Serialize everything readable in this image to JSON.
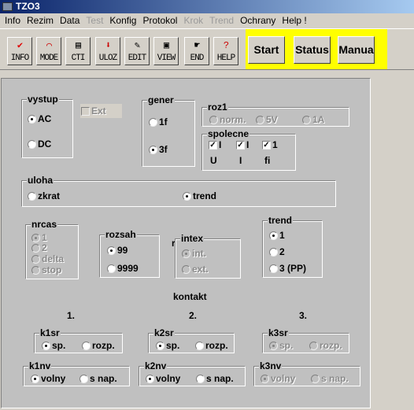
{
  "window": {
    "title": "TZO3"
  },
  "menu": [
    {
      "label": "Info",
      "enabled": true
    },
    {
      "label": "Rezim",
      "enabled": true
    },
    {
      "label": "Data",
      "enabled": true
    },
    {
      "label": "Test",
      "enabled": false
    },
    {
      "label": "Konfig",
      "enabled": true
    },
    {
      "label": "Protokol",
      "enabled": true
    },
    {
      "label": "Krok",
      "enabled": false
    },
    {
      "label": "Trend",
      "enabled": false
    },
    {
      "label": "Ochrany",
      "enabled": true
    },
    {
      "label": "Help !",
      "enabled": true
    }
  ],
  "toolbar": [
    {
      "label": "INFO",
      "icon": "checkmark-icon"
    },
    {
      "label": "MODE",
      "icon": "chart-icon"
    },
    {
      "label": "CTI",
      "icon": "document-icon"
    },
    {
      "label": "ULOZ",
      "icon": "save-icon"
    },
    {
      "label": "EDIT",
      "icon": "edit-icon"
    },
    {
      "label": "VIEW",
      "icon": "view-icon"
    },
    {
      "label": "END",
      "icon": "exit-icon"
    },
    {
      "label": "HELP",
      "icon": "help-icon"
    }
  ],
  "actions": {
    "start": "Start",
    "status": "Status",
    "manual": "Manua",
    "highlight": "#ffff00"
  },
  "vystup": {
    "label": "vystup",
    "options": [
      "AC",
      "DC"
    ],
    "selected": "AC"
  },
  "ext": {
    "label": "Ext",
    "checked": false,
    "enabled": false
  },
  "gener": {
    "label": "gener",
    "options": [
      "1f",
      "3f"
    ],
    "selected": "3f"
  },
  "roz1": {
    "label": "roz1",
    "options": [
      "norm.",
      "5V",
      "1A"
    ],
    "selected": null,
    "enabled": false
  },
  "spolecne": {
    "label": "spolecne",
    "checks": [
      {
        "mark": "I",
        "label": "U",
        "checked": true
      },
      {
        "mark": "I",
        "label": "I",
        "checked": true
      },
      {
        "mark": "1",
        "label": "fi",
        "checked": true
      }
    ]
  },
  "uloha": {
    "label": "uloha",
    "options": [
      "zkrat",
      "trend"
    ],
    "selected": "trend"
  },
  "nrcas": {
    "label": "nrcas",
    "options": [
      "1",
      "2",
      "delta",
      "stop"
    ],
    "selected": "1",
    "enabled": false
  },
  "rozsah": {
    "label": "rozsah",
    "options": [
      "99",
      "9999"
    ],
    "selected": "99"
  },
  "stray_label": "r",
  "intex": {
    "label": "intex",
    "options": [
      "int.",
      "ext."
    ],
    "selected": "int.",
    "enabled": false
  },
  "trend": {
    "label": "trend",
    "options": [
      "1",
      "2",
      "3 (PP)"
    ],
    "selected": "1"
  },
  "kontakt": {
    "label": "kontakt",
    "columns": [
      "1.",
      "2.",
      "3."
    ]
  },
  "k1sr": {
    "label": "k1sr",
    "options": [
      "sp.",
      "rozp."
    ],
    "selected": "sp."
  },
  "k2sr": {
    "label": "k2sr",
    "options": [
      "sp.",
      "rozp."
    ],
    "selected": "sp."
  },
  "k3sr": {
    "label": "k3sr",
    "options": [
      "sp.",
      "rozp."
    ],
    "selected": "sp.",
    "enabled": false
  },
  "k1nv": {
    "label": "k1nv",
    "options": [
      "volny",
      "s nap."
    ],
    "selected": "volny"
  },
  "k2nv": {
    "label": "k2nv",
    "options": [
      "volny",
      "s nap."
    ],
    "selected": "volny"
  },
  "k3nv": {
    "label": "k3nv",
    "options": [
      "volny",
      "s nap."
    ],
    "selected": "volny",
    "enabled": false
  }
}
